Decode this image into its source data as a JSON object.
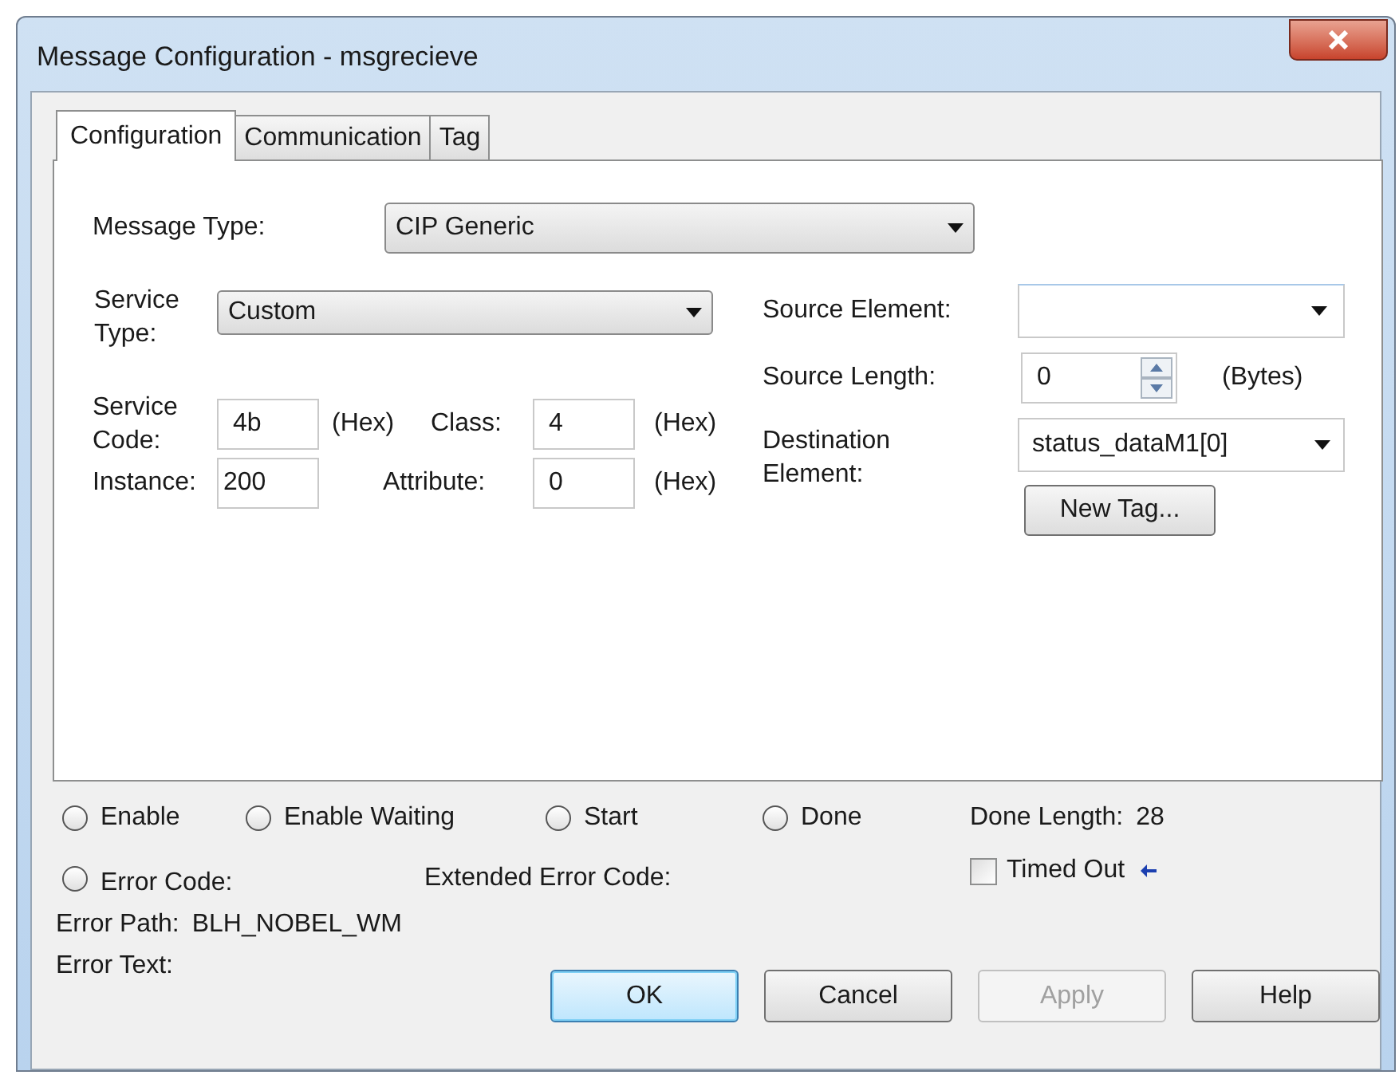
{
  "window": {
    "title": "Message Configuration - msgrecieve"
  },
  "tabs": [
    {
      "label": "Configuration",
      "selected": true
    },
    {
      "label": "Communication",
      "selected": false
    },
    {
      "label": "Tag",
      "selected": false
    }
  ],
  "message_type": {
    "label": "Message Type:",
    "value": "CIP Generic"
  },
  "service_type": {
    "label": "Service Type:",
    "value": "Custom"
  },
  "service_code": {
    "label": "Service Code:",
    "value": "4b",
    "unit": "(Hex)"
  },
  "class": {
    "label": "Class:",
    "value": "4",
    "unit": "(Hex)"
  },
  "instance": {
    "label": "Instance:",
    "value": "200"
  },
  "attribute": {
    "label": "Attribute:",
    "value": "0",
    "unit": "(Hex)"
  },
  "source_element": {
    "label": "Source Element:"
  },
  "source_length": {
    "label": "Source Length:",
    "value": "0",
    "unit": "(Bytes)"
  },
  "destination_element": {
    "label": "Destination Element:",
    "value": "status_dataM1[0]"
  },
  "new_tag_button": {
    "label": "New Tag..."
  },
  "status_flags": [
    {
      "label": "Enable",
      "on": false
    },
    {
      "label": "Enable Waiting",
      "on": false
    },
    {
      "label": "Start",
      "on": false
    },
    {
      "label": "Done",
      "on": false
    }
  ],
  "done_length": {
    "label": "Done Length:",
    "value": "28"
  },
  "error_code": {
    "label": "Error Code:",
    "on": false
  },
  "extended_error_code": {
    "label": "Extended Error Code:"
  },
  "timed_out": {
    "label": "Timed Out",
    "checked": false
  },
  "error_path": {
    "label": "Error Path:",
    "value": "BLH_NOBEL_WM"
  },
  "error_text": {
    "label": "Error Text:"
  },
  "buttons": [
    {
      "label": "OK",
      "default": true,
      "disabled": false
    },
    {
      "label": "Cancel",
      "default": false,
      "disabled": false
    },
    {
      "label": "Apply",
      "default": false,
      "disabled": true
    },
    {
      "label": "Help",
      "default": false,
      "disabled": false
    }
  ]
}
